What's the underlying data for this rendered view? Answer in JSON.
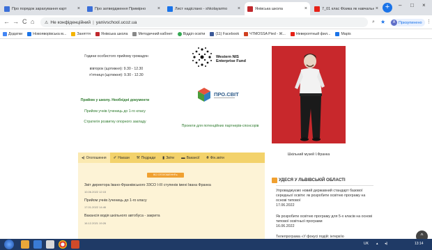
{
  "browser": {
    "tabs": [
      {
        "title": "Про порядок зарахування карт",
        "color": "#3b6fd8",
        "active": false
      },
      {
        "title": "Про затвердження Примірно",
        "color": "#3b6fd8",
        "active": false
      },
      {
        "title": "Лист надіслано - shkolayarmo",
        "color": "#1a73e8",
        "active": false
      },
      {
        "title": "Янівська школа",
        "color": "#c0282d",
        "active": true
      },
      {
        "title": "7_01 клас Фізика як навчальн",
        "color": "#e62117",
        "active": false
      }
    ],
    "newtab_label": "+",
    "window_controls": [
      "–",
      "□",
      "×"
    ],
    "nav": {
      "back": "←",
      "forward": "→",
      "reload": "C",
      "home": "⌂"
    },
    "security_label": "Не конфіденційний",
    "url": "yanivschool.ucoz.ua",
    "profile_label": "Призупинено",
    "profile_initial": "A",
    "bookmarks": [
      {
        "label": "Додатки",
        "color": "#4285f4"
      },
      {
        "label": "Новояворівська м...",
        "color": "#1a73e8"
      },
      {
        "label": "Заняття",
        "color": "#f4b400"
      },
      {
        "label": "Янівська школа",
        "color": "#c0282d"
      },
      {
        "label": "Методичний кабінет",
        "color": "#888888"
      },
      {
        "label": "Відділ освіти",
        "color": "#34a853"
      },
      {
        "label": "(11) Facebook",
        "color": "#3b5998"
      },
      {
        "label": "ЧТМОSSA Pied - Ж...",
        "color": "#d04020"
      },
      {
        "label": "Невероятный фил...",
        "color": "#e62117"
      },
      {
        "label": "Мapis",
        "color": "#1a73e8"
      }
    ]
  },
  "page": {
    "hours_title": "Години особистого прийому громадян",
    "hours_line1": "вівторок (щотижня): 9.30 - 12.30",
    "hours_line2": "п'ятниця (щотижня): 9.30 - 12.30",
    "partner1_line1": "Western NIS",
    "partner1_line2": "Enterprise Fund",
    "partner2": "ПРО.СВІТ",
    "admission_link": "Прийом у школу. Необхідні документи",
    "first_grade_link": "Прийом учнів /учениць до 1-го класу",
    "strategy_link": "Стратегія розвитку опорного закладу",
    "projects_link": "Проекти для потенційних партнерів-спонсорів",
    "museum_caption": "Шкільний музей І.Франка",
    "menu": [
      {
        "icon": "◂)",
        "label": "Оголошення",
        "active": true
      },
      {
        "icon": "✐",
        "label": "Накази",
        "active": false
      },
      {
        "icon": "⚒",
        "label": "Педради",
        "active": false
      },
      {
        "icon": "▮",
        "label": "Звіти",
        "active": false
      },
      {
        "icon": "▬",
        "label": "Вакансії",
        "active": false
      },
      {
        "icon": "₴",
        "label": "Фін.звіти",
        "active": false
      }
    ],
    "all_announcements_button": "ВСІ ОГОЛОШЕННЯ ▸",
    "news": [
      {
        "title": "Звіт директора Івано-Франківського ЗЗСО І-ІІІ ступенів імені Івана Франка",
        "date": "10.06.2022 12:15"
      },
      {
        "title": "Прийом учнів /учениць до 1-го класу",
        "date": "17.01.2022 14:46"
      },
      {
        "title": "Вакансія водія шкільного автобуса - закрита",
        "date": "16.12.2021 19:26"
      }
    ],
    "right_heading": "УДЕСЯ У ЛЬВІВСЬКІЙ ОБЛАСТІ",
    "right_items": [
      {
        "text": "Упроваджуємо новий державний стандарт базової середньої освіти: як розробити освітню програму на основі типової",
        "date": "17.06.2022"
      },
      {
        "text": "Як розробити освітню програму для 5-х класів на основі типової освітньої програми",
        "date": "16.06.2022"
      },
      {
        "text": "Телепрограма «У фокусі подій: інтерв'ю",
        "date": ""
      }
    ],
    "scroll_up_icon": "^"
  },
  "taskbar": {
    "tray_lang": "UK",
    "tray_time": "13:14"
  },
  "colors": {
    "accent_yellow": "#f3d26b",
    "link_green": "#2d7a2d",
    "button_orange": "#f0a030",
    "taskbar": "#1f3a66"
  }
}
